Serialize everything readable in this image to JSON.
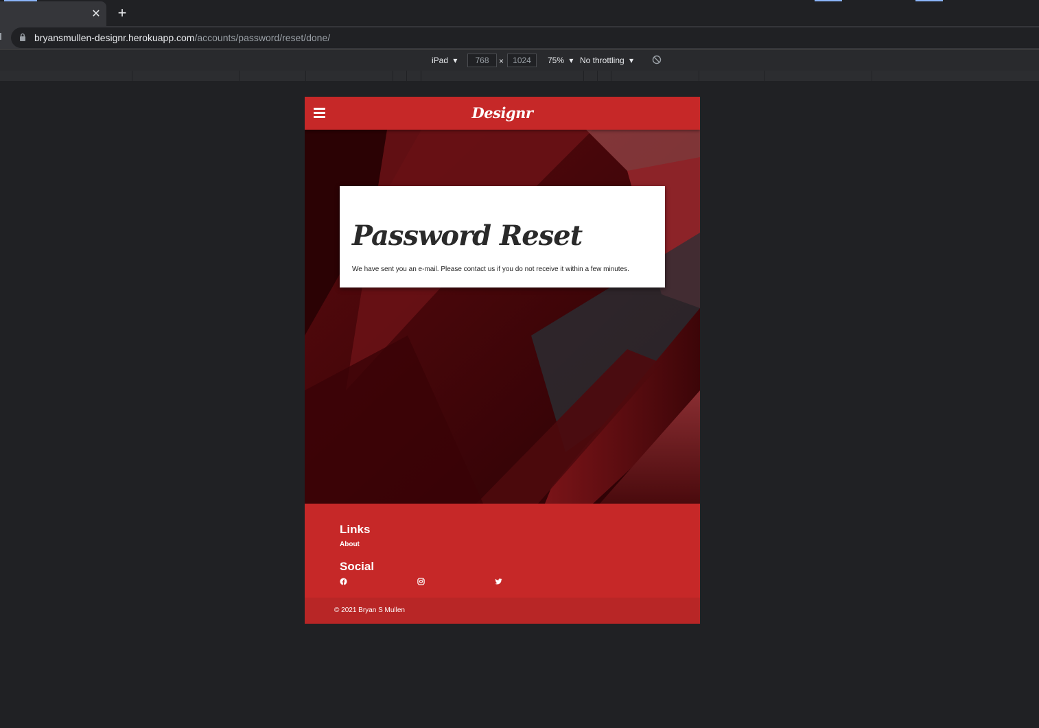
{
  "browser": {
    "tab_close_glyph": "✕",
    "new_tab_glyph": "+",
    "url_host": "bryansmullen-designr.herokuapp.com",
    "url_path": "/accounts/password/reset/done/"
  },
  "devtools": {
    "device": "iPad",
    "width": "768",
    "times": "×",
    "height": "1024",
    "zoom": "75%",
    "throttling": "No throttling",
    "caret": "▾"
  },
  "site": {
    "brand": "Designr",
    "card": {
      "title": "Password Reset",
      "message": "We have sent you an e-mail. Please contact us if you do not receive it within a few minutes."
    },
    "footer": {
      "links_heading": "Links",
      "about_link": "About",
      "social_heading": "Social",
      "social_icons": [
        "facebook-icon",
        "instagram-icon",
        "twitter-icon"
      ],
      "copyright": "© 2021 Bryan S Mullen"
    },
    "colors": {
      "brand_red": "#c62828",
      "hero_dark": "#3a0206",
      "card_bg": "#ffffff"
    }
  }
}
